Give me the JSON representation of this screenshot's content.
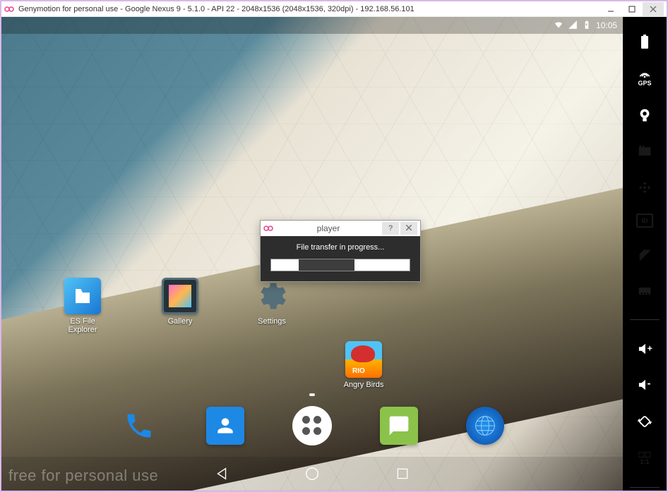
{
  "window": {
    "title": "Genymotion for personal use - Google Nexus 9 - 5.1.0 - API 22 - 2048x1536 (2048x1536, 320dpi) - 192.168.56.101"
  },
  "statusbar": {
    "time": "10:05"
  },
  "apps": {
    "es": "ES File Explorer",
    "gallery": "Gallery",
    "settings": "Settings",
    "angrybirds": "Angry Birds"
  },
  "watermark": "free for personal use",
  "dialog": {
    "title": "player",
    "message": "File transfer in progress..."
  },
  "sidepanel": {
    "gps": "GPS",
    "id": "ID",
    "ratio": "1:1"
  }
}
